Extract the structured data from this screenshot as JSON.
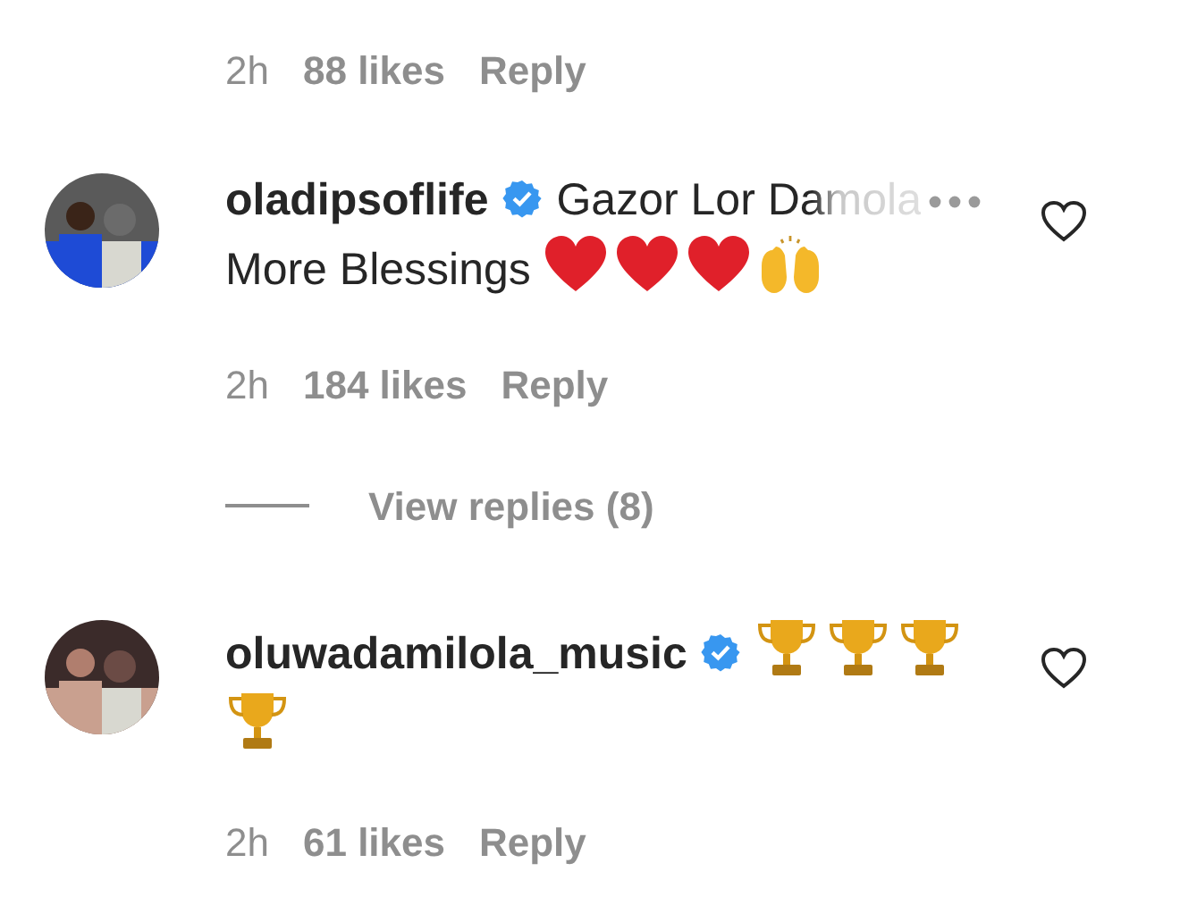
{
  "previous_comment_footer": {
    "time": "2h",
    "likes": "88 likes",
    "reply": "Reply"
  },
  "comments": [
    {
      "username": "oladipsoflife",
      "verified": true,
      "liked": false,
      "segments": [
        {
          "kind": "text",
          "text": "Gazor Lor Damola",
          "faded": true
        },
        {
          "kind": "more"
        },
        {
          "kind": "break"
        },
        {
          "kind": "text",
          "text": "More Blessings",
          "faded": false
        },
        {
          "kind": "heart"
        },
        {
          "kind": "heart"
        },
        {
          "kind": "heart"
        },
        {
          "kind": "raised-hands"
        }
      ],
      "footer": {
        "time": "2h",
        "likes": "184 likes",
        "reply": "Reply"
      },
      "view_replies": "View replies (8)"
    },
    {
      "username": "oluwadamilola_music",
      "verified": true,
      "liked": false,
      "segments": [
        {
          "kind": "trophy"
        },
        {
          "kind": "trophy"
        },
        {
          "kind": "trophy"
        },
        {
          "kind": "trophy"
        }
      ],
      "footer": {
        "time": "2h",
        "likes": "61 likes",
        "reply": "Reply"
      }
    }
  ]
}
